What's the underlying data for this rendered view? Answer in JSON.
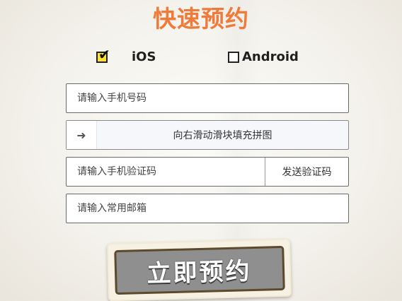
{
  "title": "快速预约",
  "platforms": [
    {
      "label": "iOS",
      "checked": true
    },
    {
      "label": "Android",
      "checked": false
    }
  ],
  "form": {
    "phone_placeholder": "请输入手机号码",
    "slider_text": "向右滑动滑块填充拼图",
    "slider_arrow": "➜",
    "code_placeholder": "请输入手机验证码",
    "send_code_label": "发送验证码",
    "email_placeholder": "请输入常用邮箱"
  },
  "submit_label": "立即预约",
  "colors": {
    "title": "#f07a3a",
    "checkbox_checked": "#ffe135",
    "submit_bg": "#8f8f8f",
    "submit_border": "#5c4a2d"
  }
}
